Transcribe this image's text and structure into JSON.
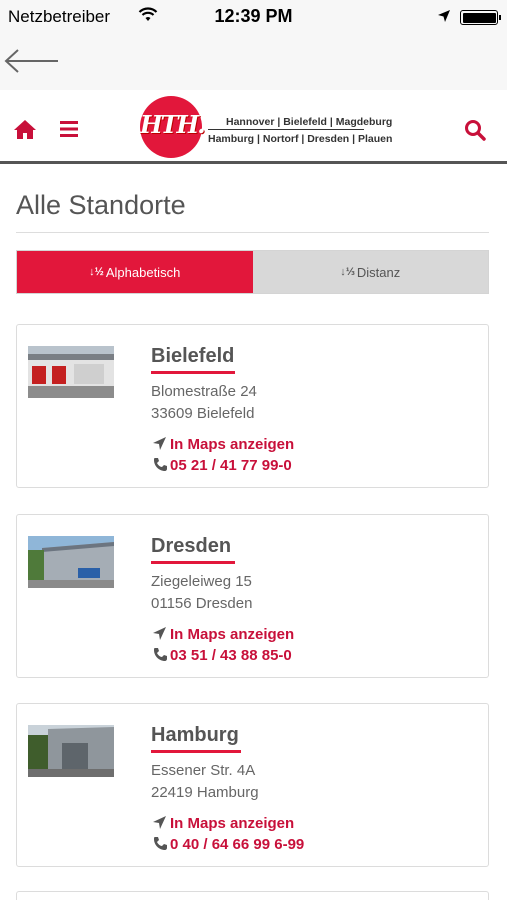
{
  "status_bar": {
    "carrier": "Netzbetreiber",
    "time": "12:39 PM"
  },
  "header": {
    "logo_mark": "HTH.",
    "logo_cities_line1": "Hannover | Bielefeld | Magdeburg",
    "logo_cities_line2": "Hamburg | Nortorf | Dresden | Plauen"
  },
  "page": {
    "title": "Alle Standorte",
    "sort_tabs": [
      {
        "icon": "↓½",
        "label": "Alphabetisch",
        "active": true
      },
      {
        "icon": "↓⅓",
        "label": "Distanz",
        "active": false
      }
    ]
  },
  "locations": [
    {
      "name": "Bielefeld",
      "street": "Blomestraße 24",
      "city": "33609 Bielefeld",
      "maps_label": "In Maps anzeigen",
      "phone": "05 21 / 41 77 99-0"
    },
    {
      "name": "Dresden",
      "street": "Ziegeleiweg 15",
      "city": "01156 Dresden",
      "maps_label": "In Maps anzeigen",
      "phone": "03 51 / 43 88 85-0"
    },
    {
      "name": "Hamburg",
      "street": "Essener Str. 4A",
      "city": "22419 Hamburg",
      "maps_label": "In Maps anzeigen",
      "phone": "0 40 / 64 66 99 6-99"
    }
  ],
  "colors": {
    "accent": "#e2173b",
    "link": "#c8103a",
    "inactive_tab": "#d8d8d8"
  },
  "icons": [
    "wifi-icon",
    "location-arrow-icon",
    "battery-icon",
    "back-arrow-icon",
    "home-icon",
    "menu-icon",
    "search-icon",
    "sort-alpha-icon",
    "sort-distance-icon",
    "navigation-arrow-icon",
    "phone-icon"
  ]
}
